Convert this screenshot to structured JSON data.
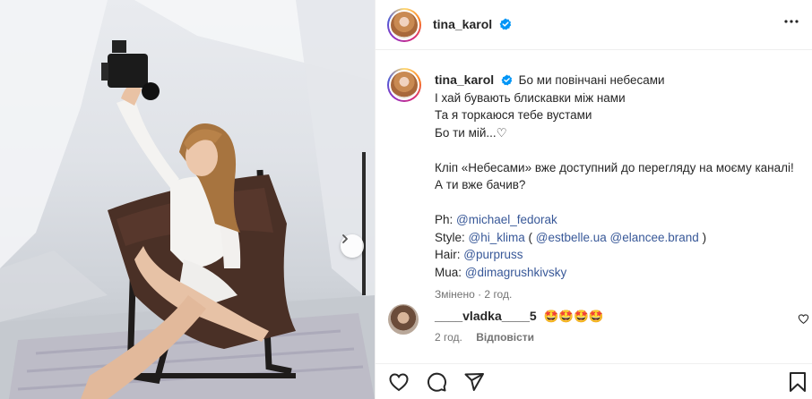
{
  "post": {
    "username": "tina_karol",
    "verified": true,
    "icons": {
      "verified": "verified-badge-icon",
      "more": "more-options-icon",
      "next": "chevron-right-icon",
      "like": "heart-icon",
      "comment": "comment-icon",
      "share": "share-icon",
      "save": "bookmark-icon"
    },
    "colors": {
      "link": "#385898",
      "verified": "#0095f6",
      "meta": "#737373"
    }
  },
  "caption": {
    "username": "tina_karol",
    "line1": "Бо ми повінчані небесами",
    "line2": "І хай бувають блискавки між нами",
    "line3": "Та я торкаюся тебе вустами",
    "line4": "Бо ти мій...♡",
    "line5": "Кліп «Небесами» вже доступний до перегляду на моєму каналі!",
    "line6": "А ти вже бачив?",
    "credits": {
      "ph_label": "Ph: ",
      "ph_link": "@michael_fedorak",
      "style_label": "Style: ",
      "style_link1": "@hi_klima",
      "style_open": " ( ",
      "style_link2": "@estbelle.ua",
      "style_space": " ",
      "style_link3": "@elancee.brand",
      "style_close": " )",
      "hair_label": "Hair: ",
      "hair_link": "@purpruss",
      "mua_label": "Mua: ",
      "mua_link": "@dimagrushkivsky"
    },
    "edited": "Змінено · 2 год."
  },
  "comment": {
    "username": "____vladka____5",
    "text": "🤩🤩🤩🤩",
    "time": "2 год.",
    "reply": "Відповісти"
  }
}
